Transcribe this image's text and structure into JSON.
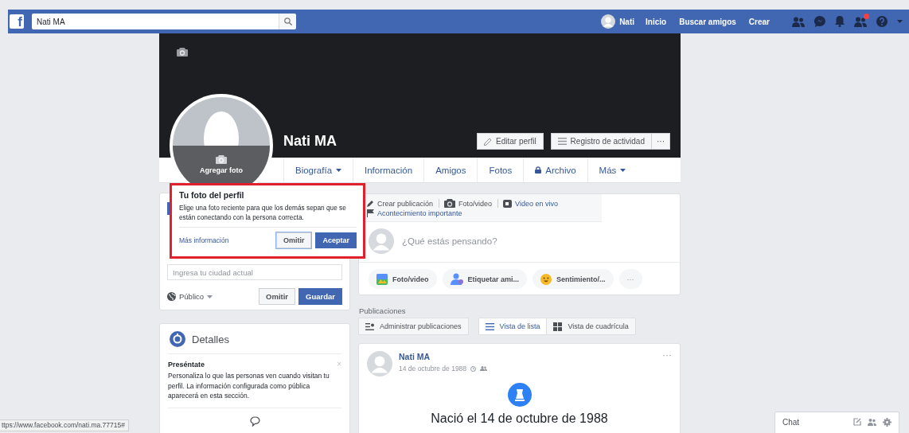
{
  "top_bar": {
    "logo": "f",
    "search": {
      "value": "Nati MA"
    },
    "user": "Nati",
    "links": [
      "Inicio",
      "Buscar amigos",
      "Crear"
    ],
    "notifications": [
      {
        "kind": "friends",
        "unread": false
      },
      {
        "kind": "messages",
        "unread": false
      },
      {
        "kind": "bell",
        "unread": false
      },
      {
        "kind": "requests",
        "unread": true
      },
      {
        "kind": "help",
        "unread": false
      }
    ]
  },
  "profile": {
    "name": "Nati MA",
    "add_photo": "Agregar foto",
    "edit": "Editar perfil",
    "activity": "Registro de actividad",
    "more": "···",
    "tabs": [
      {
        "label": "Biografía",
        "dropdown": true,
        "locked": false
      },
      {
        "label": "Información",
        "dropdown": false,
        "locked": false
      },
      {
        "label": "Amigos",
        "dropdown": false,
        "locked": false
      },
      {
        "label": "Fotos",
        "dropdown": false,
        "locked": false
      },
      {
        "label": "Archivo",
        "dropdown": false,
        "locked": true
      },
      {
        "label": "Más",
        "dropdown": true,
        "locked": false
      }
    ]
  },
  "popup": {
    "title": "Tu foto del perfil",
    "text": "Elige una foto reciente para que los demás sepan que se están conectando con la persona correcta.",
    "link": "Más información",
    "buttons": [
      {
        "label": "Omitir",
        "primary": false
      },
      {
        "label": "Aceptar",
        "primary": true
      }
    ]
  },
  "city_card": {
    "placeholder": "Ingresa tu ciudad actual",
    "audience": "Público",
    "buttons": [
      {
        "label": "Omitir",
        "primary": false
      },
      {
        "label": "Guardar",
        "primary": true
      }
    ]
  },
  "details": {
    "title": "Detalles",
    "heading": "Preséntate",
    "close": "×",
    "text": "Personaliza lo que las personas ven cuando visitan tu perfil. La información configurada como pública aparecerá en esta sección."
  },
  "composer": {
    "actions": [
      {
        "kind": "edit",
        "label": "Crear publicación"
      },
      {
        "kind": "camera",
        "label": "Foto/video"
      },
      {
        "kind": "video",
        "label": "Video en vivo"
      },
      {
        "kind": "flag",
        "label": "Acontecimiento importante"
      }
    ],
    "placeholder": "¿Qué estás pensando?",
    "options": [
      {
        "kind": "photo",
        "label": "Foto/video"
      },
      {
        "kind": "tag",
        "label": "Etiquetar ami..."
      },
      {
        "kind": "feeling",
        "label": "Sentimiento/..."
      },
      {
        "kind": "more",
        "label": "···"
      }
    ]
  },
  "posts": {
    "title": "Publicaciones",
    "manage": "Administrar publicaciones",
    "views": [
      {
        "kind": "list",
        "label": "Vista de lista",
        "selected": true
      },
      {
        "kind": "grid",
        "label": "Vista de cuadrícula",
        "selected": false
      }
    ]
  },
  "post": {
    "author": "Nati MA",
    "date": "14 de octubre de 1988",
    "menu": "···",
    "event": "Nació el 14 de octubre de 1988"
  },
  "chat": {
    "title": "Chat"
  },
  "status_bar": {
    "url": "ttps://www.facebook.com/nati.ma.77715#"
  }
}
